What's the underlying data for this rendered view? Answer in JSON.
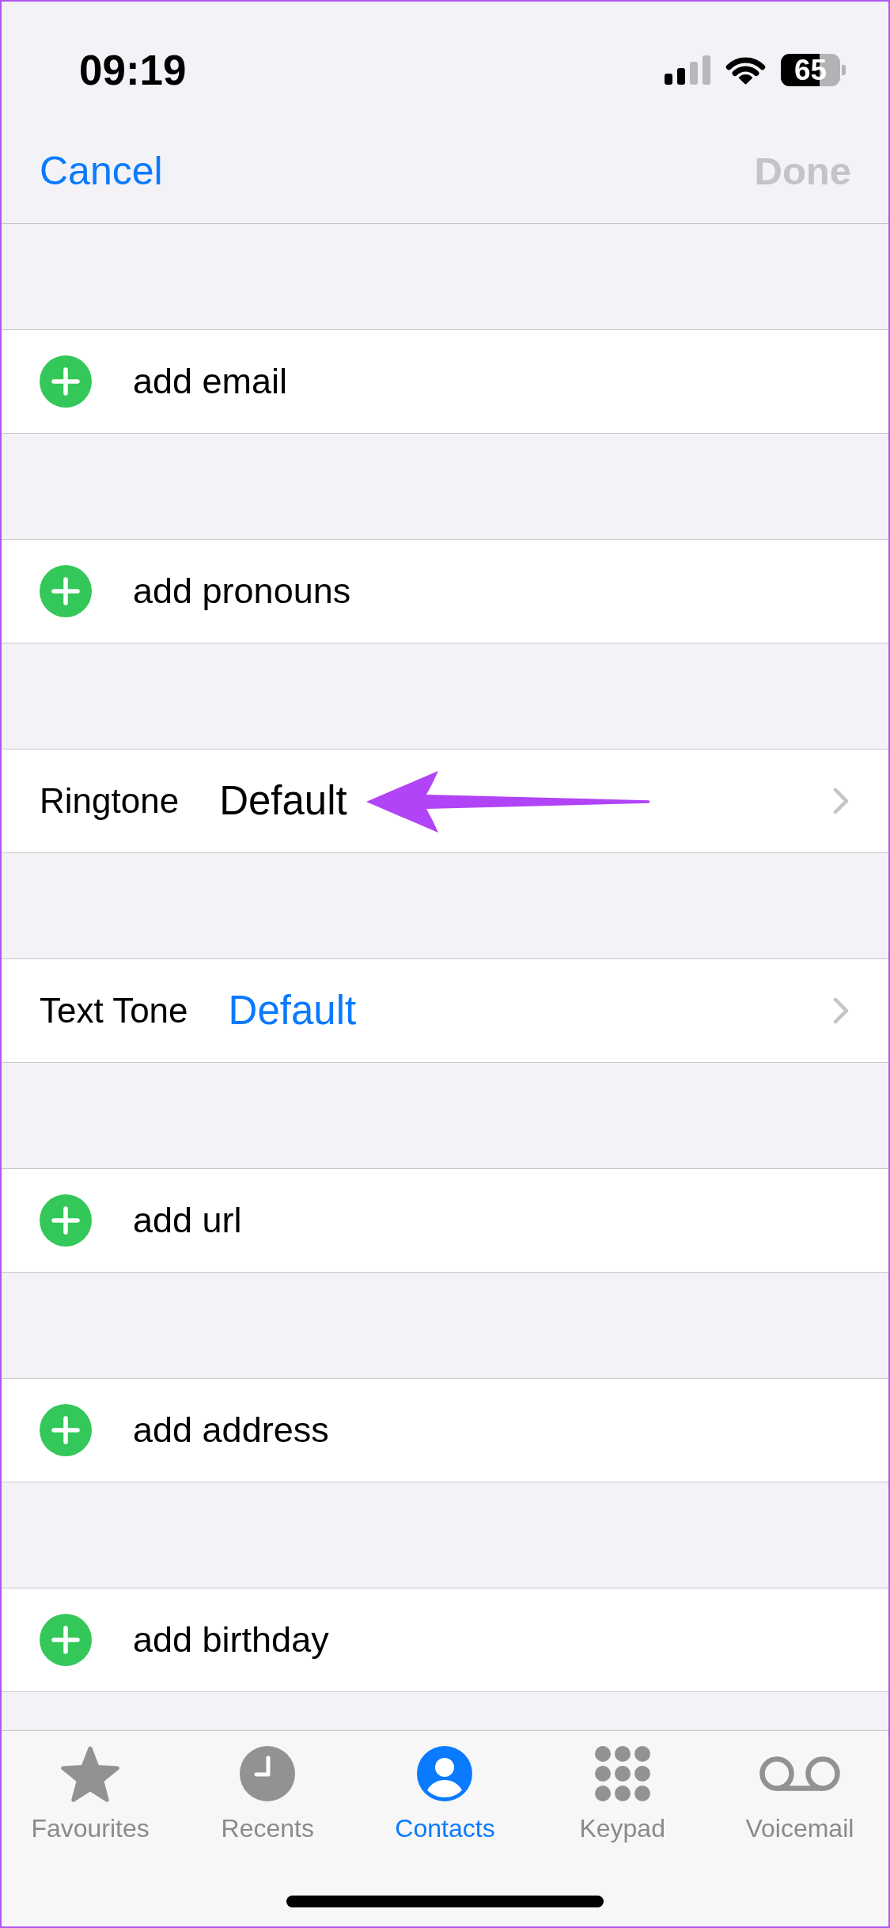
{
  "status_bar": {
    "time": "09:19",
    "battery": "65"
  },
  "nav_bar": {
    "cancel": "Cancel",
    "done": {
      "label": "Done",
      "disabled": true
    }
  },
  "sections": [
    {
      "kind": "add",
      "label": "add email"
    },
    {
      "kind": "add",
      "label": "add pronouns"
    },
    {
      "kind": "tone",
      "label": "Ringtone",
      "value": "Default",
      "color": "#000000",
      "arrow": true
    },
    {
      "kind": "tone",
      "label": "Text Tone",
      "value": "Default",
      "color": "#0a7aff",
      "arrow": false
    },
    {
      "kind": "add",
      "label": "add url"
    },
    {
      "kind": "add",
      "label": "add address"
    },
    {
      "kind": "add",
      "label": "add birthday"
    }
  ],
  "tab_bar": {
    "tabs": [
      {
        "kind": "favourites",
        "label": "Favourites",
        "selected": false
      },
      {
        "kind": "recents",
        "label": "Recents",
        "selected": false
      },
      {
        "kind": "contacts",
        "label": "Contacts",
        "selected": true
      },
      {
        "kind": "keypad",
        "label": "Keypad",
        "selected": false
      },
      {
        "kind": "voicemail",
        "label": "Voicemail",
        "selected": false
      }
    ]
  }
}
